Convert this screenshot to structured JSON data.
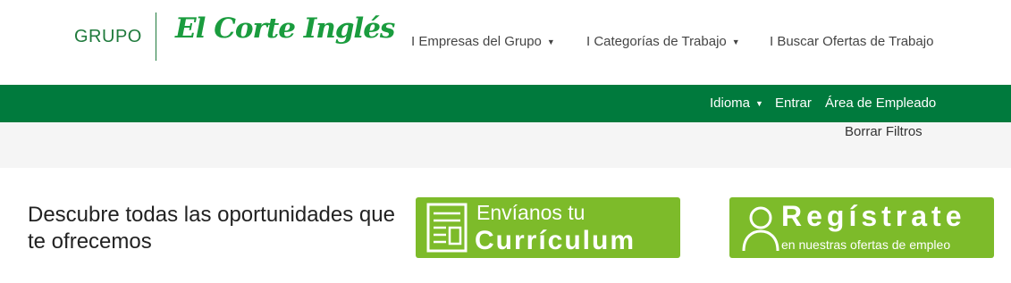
{
  "header": {
    "logo_group": "GRUPO",
    "logo_brand": "El Corte Inglés",
    "nav": [
      {
        "label": "I Empresas del Grupo"
      },
      {
        "label": "I Categorías de Trabajo"
      },
      {
        "label": "I Buscar Ofertas de Trabajo"
      }
    ],
    "caret_icon": "chevron-down-icon"
  },
  "utility_bar": {
    "idioma": "Idioma",
    "entrar": "Entrar",
    "area_empleado": "Área de Empleado"
  },
  "filters": {
    "clear_label": "Borrar Filtros"
  },
  "main": {
    "headline": "Descubre todas las oportunidades que te ofrecemos",
    "cv_banner": {
      "line1": "Envíanos tu",
      "line2": "Currículum",
      "icon": "document-icon"
    },
    "register_banner": {
      "line1": "Regístrate",
      "line2": "en nuestras ofertas de empleo",
      "icon": "user-icon"
    }
  },
  "colors": {
    "brand_green": "#007a3d",
    "banner_green": "#7dbb2a",
    "logo_green": "#1a9c3e"
  }
}
